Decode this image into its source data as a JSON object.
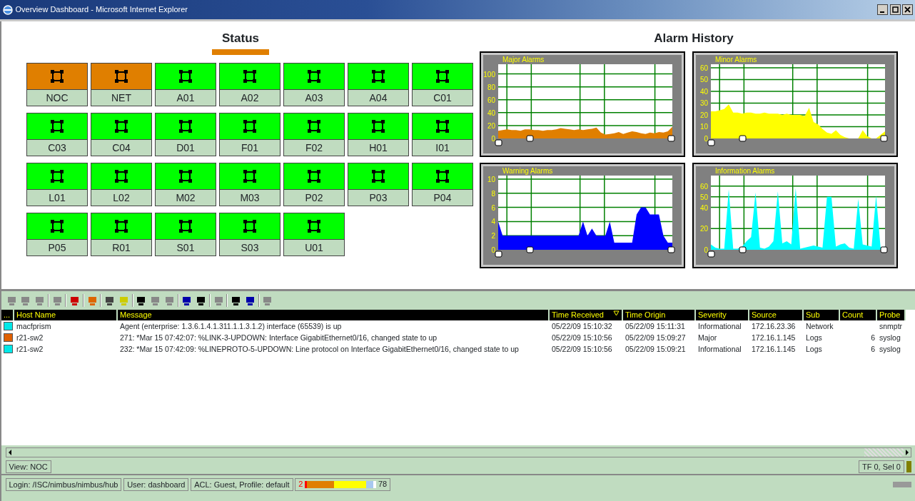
{
  "window": {
    "title": "Overview Dashboard - Microsoft Internet Explorer"
  },
  "status": {
    "heading": "Status",
    "tiles": [
      {
        "label": "NOC",
        "color": "#e07f00"
      },
      {
        "label": "NET",
        "color": "#e07f00"
      },
      {
        "label": "A01",
        "color": "#00ff00"
      },
      {
        "label": "A02",
        "color": "#00ff00"
      },
      {
        "label": "A03",
        "color": "#00ff00"
      },
      {
        "label": "A04",
        "color": "#00ff00"
      },
      {
        "label": "C01",
        "color": "#00ff00"
      },
      {
        "label": "C03",
        "color": "#00ff00"
      },
      {
        "label": "C04",
        "color": "#00ff00"
      },
      {
        "label": "D01",
        "color": "#00ff00"
      },
      {
        "label": "F01",
        "color": "#00ff00"
      },
      {
        "label": "F02",
        "color": "#00ff00"
      },
      {
        "label": "H01",
        "color": "#00ff00"
      },
      {
        "label": "I01",
        "color": "#00ff00"
      },
      {
        "label": "L01",
        "color": "#00ff00"
      },
      {
        "label": "L02",
        "color": "#00ff00"
      },
      {
        "label": "M02",
        "color": "#00ff00"
      },
      {
        "label": "M03",
        "color": "#00ff00"
      },
      {
        "label": "P02",
        "color": "#00ff00"
      },
      {
        "label": "P03",
        "color": "#00ff00"
      },
      {
        "label": "P04",
        "color": "#00ff00"
      },
      {
        "label": "P05",
        "color": "#00ff00"
      },
      {
        "label": "R01",
        "color": "#00ff00"
      },
      {
        "label": "S01",
        "color": "#00ff00"
      },
      {
        "label": "S03",
        "color": "#00ff00"
      },
      {
        "label": "U01",
        "color": "#00ff00"
      }
    ]
  },
  "alarm_history": {
    "heading": "Alarm History",
    "charts": [
      {
        "chart_data": {
          "type": "area",
          "title": "Major Alarms",
          "ylim": [
            0,
            115
          ],
          "yticks": [
            0,
            20,
            40,
            60,
            80,
            100
          ],
          "grid": true,
          "series": [
            {
              "color": "#e07f00",
              "values": [
                12,
                13,
                14,
                13,
                13,
                12,
                14,
                14,
                13,
                13,
                12,
                13,
                13,
                14,
                16,
                15,
                14,
                13,
                14,
                13,
                14,
                15,
                17,
                9,
                6,
                7,
                8,
                10,
                7,
                9,
                11,
                10,
                8,
                7,
                9,
                8,
                10,
                9,
                11,
                18
              ]
            }
          ]
        }
      },
      {
        "chart_data": {
          "type": "area",
          "title": "Minor Alarms",
          "ylim": [
            0,
            63
          ],
          "yticks": [
            0,
            10,
            20,
            30,
            40,
            50,
            60
          ],
          "grid": true,
          "series": [
            {
              "color": "#ffff00",
              "values": [
                23,
                23,
                24,
                25,
                29,
                22,
                22,
                21,
                22,
                22,
                21,
                21,
                22,
                21,
                21,
                21,
                20,
                21,
                20,
                20,
                20,
                19,
                26,
                14,
                12,
                8,
                5,
                4,
                7,
                3,
                1,
                0,
                0,
                0,
                7,
                2,
                0,
                0,
                3,
                6
              ]
            }
          ]
        }
      },
      {
        "chart_data": {
          "type": "area",
          "title": "Warning Alarms",
          "ylim": [
            0,
            10.5
          ],
          "yticks": [
            0,
            2,
            4,
            6,
            8,
            10
          ],
          "grid": true,
          "series": [
            {
              "color": "#0000ff",
              "values": [
                4,
                2,
                2,
                2,
                2,
                2,
                2,
                2,
                2,
                2,
                2,
                2,
                2,
                2,
                2,
                2,
                2,
                2,
                2,
                4,
                2,
                3,
                2,
                2,
                2,
                4,
                1,
                1,
                1,
                1,
                1,
                5,
                6,
                6,
                5,
                5,
                5,
                2,
                1,
                1
              ]
            }
          ]
        }
      },
      {
        "chart_data": {
          "type": "area",
          "title": "Information Alarms",
          "ylim": [
            0,
            70
          ],
          "yticks": [
            0,
            20,
            40,
            50,
            60
          ],
          "grid": true,
          "series": [
            {
              "color": "#00ffff",
              "values": [
                5,
                2,
                1,
                1,
                57,
                1,
                1,
                3,
                8,
                12,
                54,
                2,
                1,
                3,
                8,
                55,
                6,
                8,
                5,
                58,
                1,
                2,
                3,
                4,
                3,
                2,
                50,
                50,
                3,
                5,
                6,
                2,
                1,
                48,
                5,
                4,
                3,
                51,
                2,
                3
              ]
            }
          ]
        }
      }
    ]
  },
  "table": {
    "columns": [
      {
        "label": "..."
      },
      {
        "label": "Host Name"
      },
      {
        "label": "Message"
      },
      {
        "label": "Time Received",
        "sorted": true
      },
      {
        "label": "Time Origin"
      },
      {
        "label": "Severity"
      },
      {
        "label": "Source"
      },
      {
        "label": "Sub"
      },
      {
        "label": "Count"
      },
      {
        "label": "Probe"
      }
    ],
    "rows": [
      {
        "color": "#00e8e8",
        "cells": [
          "",
          "macfprism",
          "Agent (enterprise: 1.3.6.1.4.1.311.1.1.3.1.2) interface (65539) is up",
          "05/22/09 15:10:32",
          "05/22/09 15:11:31",
          "Informational",
          "172.16.23.36",
          "Network",
          "",
          "snmptr"
        ]
      },
      {
        "color": "#e06000",
        "cells": [
          "",
          "r21-sw2",
          "271: *Mar 15 07:42:07: %LINK-3-UPDOWN: Interface GigabitEthernet0/16, changed state to up",
          "05/22/09 15:10:56",
          "05/22/09 15:09:27",
          "Major",
          "172.16.1.145",
          "Logs",
          "6",
          "syslog"
        ]
      },
      {
        "color": "#00e8e8",
        "cells": [
          "",
          "r21-sw2",
          "232: *Mar 15 07:42:09: %LINEPROTO-5-UPDOWN: Line protocol on Interface GigabitEthernet0/16, changed state to up",
          "05/22/09 15:10:56",
          "05/22/09 15:09:21",
          "Informational",
          "172.16.1.145",
          "Logs",
          "6",
          "syslog"
        ]
      }
    ]
  },
  "view_tab": {
    "label": "View: NOC"
  },
  "selection_info": "TF 0, Sel 0",
  "status_bar": {
    "login": "Login: /ISC/nimbus/nimbus/hub",
    "user": "User: dashboard",
    "acl": "ACL: Guest, Profile: default",
    "low": "2",
    "high": "78",
    "segments": [
      {
        "color": "#ff0000"
      },
      {
        "color": "#e07f00"
      },
      {
        "color": "#ffff00"
      },
      {
        "color": "#a8c8f0"
      }
    ]
  }
}
